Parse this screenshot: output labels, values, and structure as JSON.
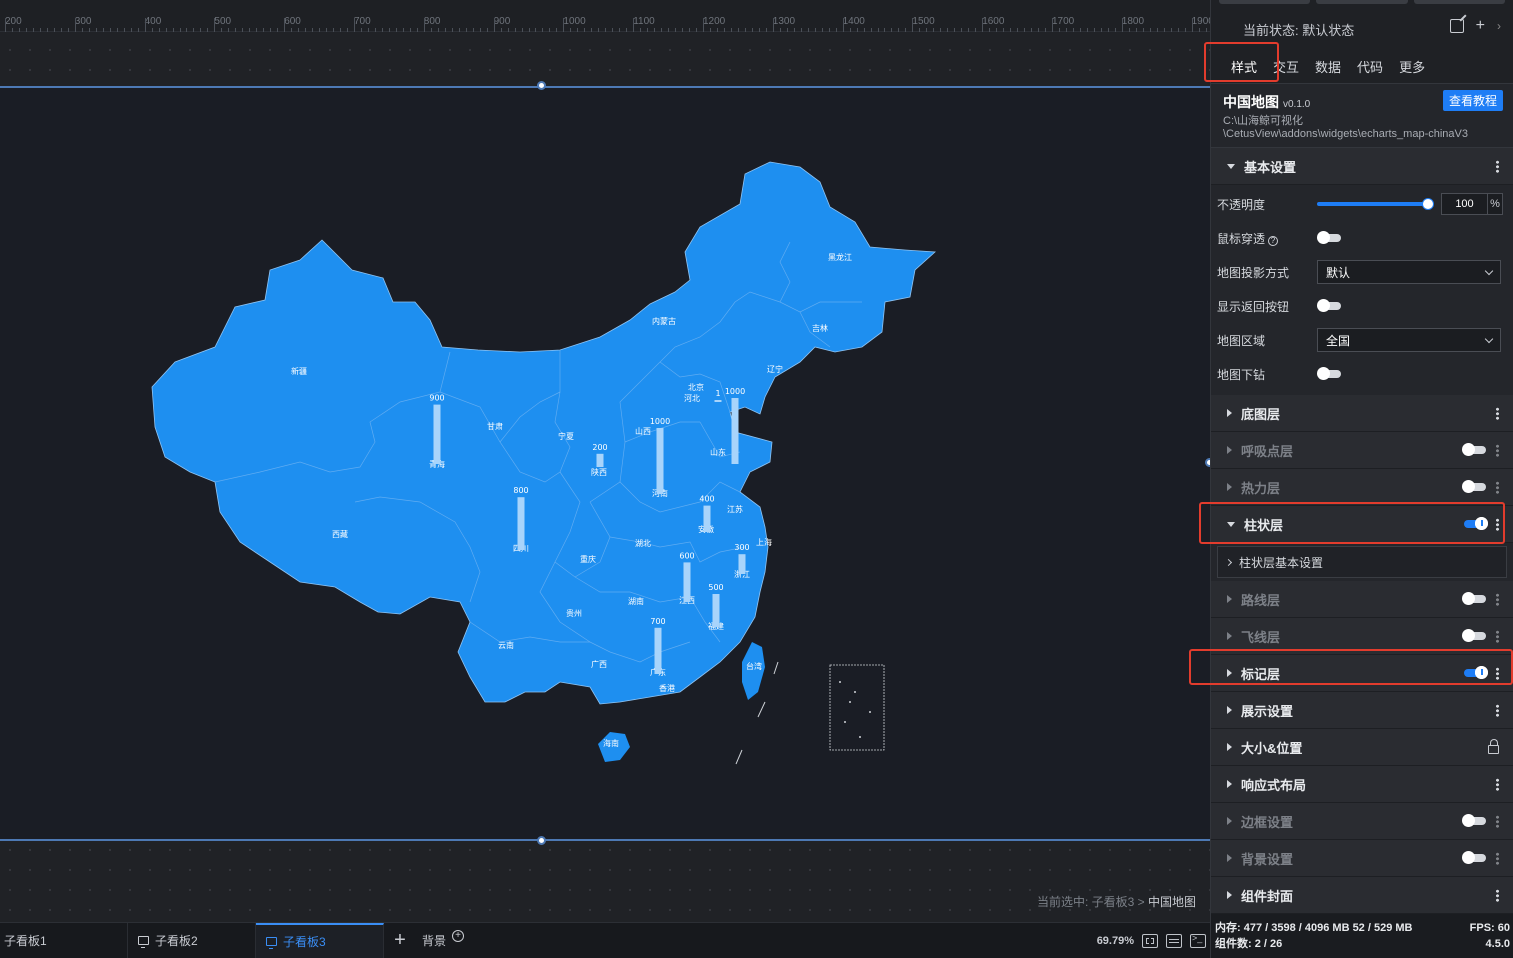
{
  "ruler": {
    "ticks": [
      "200",
      "300",
      "400",
      "500",
      "600",
      "700",
      "800",
      "900",
      "1000",
      "1100",
      "1200",
      "1300",
      "1400",
      "1500",
      "1600",
      "1700",
      "1800",
      "1900"
    ]
  },
  "map": {
    "fill_color": "#1e8ff0",
    "bar_color": "#a8d4fb",
    "provinces": [
      "新疆",
      "西藏",
      "青海",
      "甘肃",
      "内蒙古",
      "黑龙江",
      "吉林",
      "辽宁",
      "北京",
      "河北",
      "宁夏",
      "山西",
      "陕西",
      "河南",
      "山东",
      "四川",
      "重庆",
      "湖北",
      "安徽",
      "江苏",
      "上海",
      "浙江",
      "江西",
      "湖南",
      "贵州",
      "云南",
      "广西",
      "广东",
      "福建",
      "台湾",
      "香港",
      "海南"
    ],
    "bars": [
      {
        "province": "青海",
        "value": 900
      },
      {
        "province": "宁夏",
        "value": 200
      },
      {
        "province": "山西",
        "value": 1000
      },
      {
        "province": "山东",
        "value": 1000
      },
      {
        "province": "河北",
        "value": 1
      },
      {
        "province": "四川",
        "value": 800
      },
      {
        "province": "江苏",
        "value": 400
      },
      {
        "province": "上海",
        "value": 300
      },
      {
        "province": "江西",
        "value": 600
      },
      {
        "province": "福建",
        "value": 500
      },
      {
        "province": "广东",
        "value": 700
      }
    ]
  },
  "status": {
    "prefix": "当前选中: 子看板3 > ",
    "current": "中国地图"
  },
  "tabs": {
    "items": [
      "子看板1",
      "子看板2",
      "子看板3"
    ],
    "background": "背景",
    "zoom": "69.79%"
  },
  "panel": {
    "state_label": "当前状态:  默认状态",
    "main_tabs": [
      "样式",
      "交互",
      "数据",
      "代码",
      "更多"
    ],
    "widget": {
      "name": "中国地图",
      "version": "v0.1.0",
      "tutorial": "查看教程",
      "path1": "C:\\山海鲸可视化",
      "path2": "\\CetusView\\addons\\widgets\\echarts_map-chinaV3"
    },
    "basic": {
      "title": "基本设置",
      "opacity_label": "不透明度",
      "opacity_value": "100",
      "opacity_unit": "%",
      "mouse_through": "鼠标穿透",
      "projection_label": "地图投影方式",
      "projection_value": "默认",
      "back_btn_label": "显示返回按钮",
      "region_label": "地图区域",
      "region_value": "全国",
      "drill_label": "地图下钻"
    },
    "sections": {
      "base": "底图层",
      "breath": "呼吸点层",
      "heat": "热力层",
      "bar": "柱状层",
      "bar_sub": "柱状层基本设置",
      "route": "路线层",
      "fly": "飞线层",
      "marker": "标记层",
      "display": "展示设置",
      "size": "大小&位置",
      "responsive": "响应式布局",
      "border": "边框设置",
      "background": "背景设置",
      "cover": "组件封面"
    },
    "status_bar": {
      "memory": "内存:  477 / 3598 / 4096 MB  52 / 529 MB",
      "fps": "FPS:  60",
      "count": "组件数: 2 / 26",
      "version": "4.5.0"
    }
  }
}
